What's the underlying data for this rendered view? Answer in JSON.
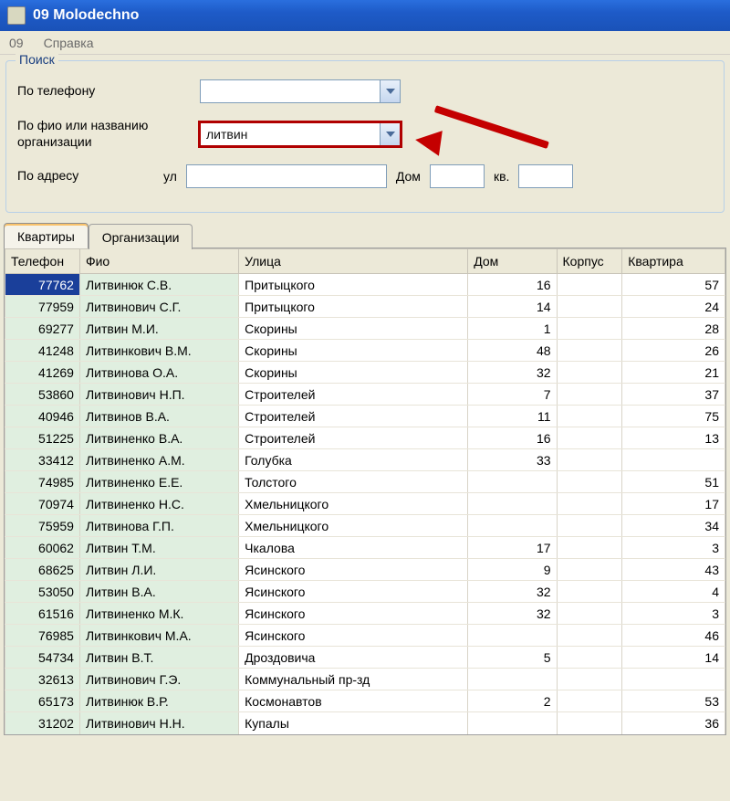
{
  "window": {
    "title": "09 Molodechno"
  },
  "menu": {
    "items": [
      "09",
      "Справка"
    ]
  },
  "search": {
    "legend": "Поиск",
    "phone_label": "По телефону",
    "phone_value": "",
    "fio_label": "По фио или названию организации",
    "fio_value": "литвин",
    "addr_label": "По адресу",
    "street_label": "ул",
    "street_value": "",
    "house_label": "Дом",
    "house_value": "",
    "flat_label": "кв.",
    "flat_value": ""
  },
  "tabs": {
    "apartments": "Квартиры",
    "orgs": "Организации"
  },
  "columns": {
    "tel": "Телефон",
    "fio": "Фио",
    "street": "Улица",
    "house": "Дом",
    "korp": "Корпус",
    "flat": "Квартира"
  },
  "rows": [
    {
      "tel": "77762",
      "fio": "Литвинюк С.В.",
      "street": "Притыцкого",
      "house": "16",
      "korp": "",
      "flat": "57",
      "selected": true
    },
    {
      "tel": "77959",
      "fio": "Литвинович С.Г.",
      "street": "Притыцкого",
      "house": "14",
      "korp": "",
      "flat": "24"
    },
    {
      "tel": "69277",
      "fio": "Литвин М.И.",
      "street": "Скорины",
      "house": "1",
      "korp": "",
      "flat": "28"
    },
    {
      "tel": "41248",
      "fio": "Литвинкович В.М.",
      "street": "Скорины",
      "house": "48",
      "korp": "",
      "flat": "26"
    },
    {
      "tel": "41269",
      "fio": "Литвинова О.А.",
      "street": "Скорины",
      "house": "32",
      "korp": "",
      "flat": "21"
    },
    {
      "tel": "53860",
      "fio": "Литвинович Н.П.",
      "street": "Строителей",
      "house": "7",
      "korp": "",
      "flat": "37"
    },
    {
      "tel": "40946",
      "fio": "Литвинов В.А.",
      "street": "Строителей",
      "house": "11",
      "korp": "",
      "flat": "75"
    },
    {
      "tel": "51225",
      "fio": "Литвиненко В.А.",
      "street": "Строителей",
      "house": "16",
      "korp": "",
      "flat": "13"
    },
    {
      "tel": "33412",
      "fio": "Литвиненко А.М.",
      "street": "Голубка",
      "house": "33",
      "korp": "",
      "flat": ""
    },
    {
      "tel": "74985",
      "fio": "Литвиненко Е.Е.",
      "street": "Толстого",
      "house": "",
      "korp": "",
      "flat": "51"
    },
    {
      "tel": "70974",
      "fio": "Литвиненко Н.С.",
      "street": "Хмельницкого",
      "house": "",
      "korp": "",
      "flat": "17"
    },
    {
      "tel": "75959",
      "fio": "Литвинова Г.П.",
      "street": "Хмельницкого",
      "house": "",
      "korp": "",
      "flat": "34"
    },
    {
      "tel": "60062",
      "fio": "Литвин Т.М.",
      "street": "Чкалова",
      "house": "17",
      "korp": "",
      "flat": "3"
    },
    {
      "tel": "68625",
      "fio": "Литвин Л.И.",
      "street": "Ясинского",
      "house": "9",
      "korp": "",
      "flat": "43"
    },
    {
      "tel": "53050",
      "fio": "Литвин В.А.",
      "street": "Ясинского",
      "house": "32",
      "korp": "",
      "flat": "4"
    },
    {
      "tel": "61516",
      "fio": "Литвиненко М.К.",
      "street": "Ясинского",
      "house": "32",
      "korp": "",
      "flat": "3"
    },
    {
      "tel": "76985",
      "fio": "Литвинкович М.А.",
      "street": "Ясинского",
      "house": "",
      "korp": "",
      "flat": "46"
    },
    {
      "tel": "54734",
      "fio": "Литвин В.Т.",
      "street": "Дроздовича",
      "house": "5",
      "korp": "",
      "flat": "14"
    },
    {
      "tel": "32613",
      "fio": "Литвинович Г.Э.",
      "street": "Коммунальный пр-зд",
      "house": "",
      "korp": "",
      "flat": ""
    },
    {
      "tel": "65173",
      "fio": "Литвинюк В.Р.",
      "street": "Космонавтов",
      "house": "2",
      "korp": "",
      "flat": "53"
    },
    {
      "tel": "31202",
      "fio": "Литвинович Н.Н.",
      "street": "Купалы",
      "house": "",
      "korp": "",
      "flat": "36"
    }
  ]
}
